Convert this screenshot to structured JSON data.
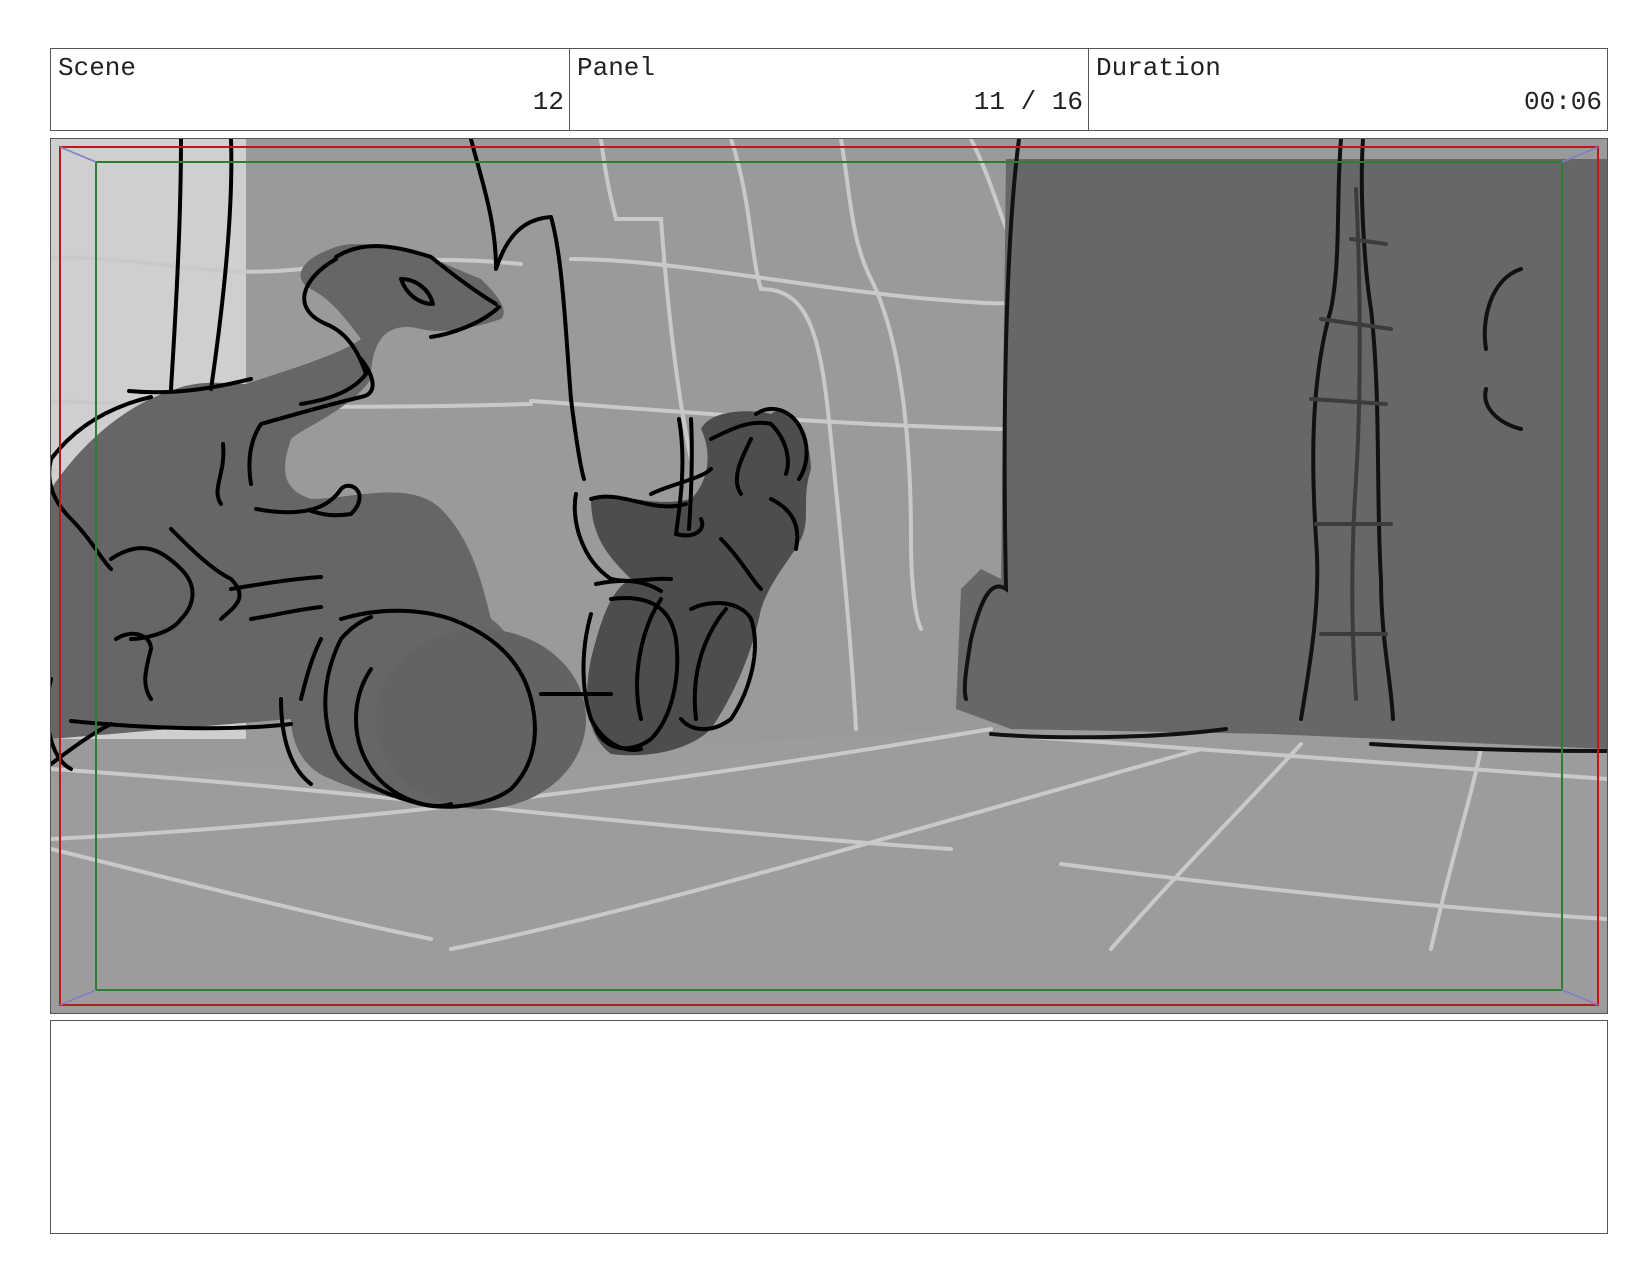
{
  "header": {
    "scene_label": "Scene",
    "scene_value": "12",
    "panel_label": "Panel",
    "panel_value": "11 / 16",
    "duration_label": "Duration",
    "duration_value": "00:06"
  },
  "frame": {
    "safe_area_color": "#2e7d32",
    "frame_edge_color": "#b71c1c",
    "corner_guide_color": "#7e7ec8"
  },
  "notes": {
    "text": ""
  }
}
